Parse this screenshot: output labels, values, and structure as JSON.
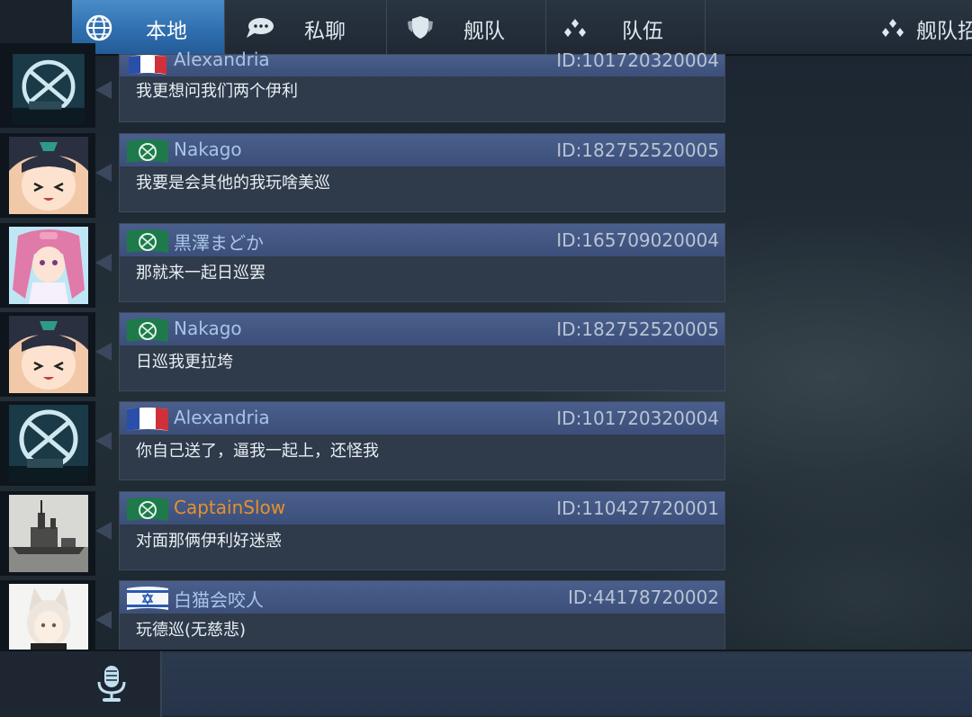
{
  "tabs": [
    {
      "label": "本地",
      "icon": "globe-icon",
      "active": true
    },
    {
      "label": "私聊",
      "icon": "speech-bubble-icon",
      "active": false
    },
    {
      "label": "舰队",
      "icon": "shield-icon",
      "active": false
    },
    {
      "label": "队伍",
      "icon": "team-dots-icon",
      "active": false
    },
    {
      "label": "舰队招",
      "icon": "team-dots-icon",
      "active": false
    }
  ],
  "messages": [
    {
      "name": "Alexandria",
      "id": "ID:101720320004",
      "text": "我更想问我们两个伊利",
      "flag": "france-flag",
      "avatar": "ship-emblem-avatar"
    },
    {
      "name": "Nakago",
      "id": "ID:182752520005",
      "text": "我要是会其他的我玩啥美巡",
      "flag": "green-emblem-flag",
      "avatar": "anime-girl-avatar"
    },
    {
      "name": "黒澤まどか",
      "id": "ID:165709020004",
      "text": "那就来一起日巡罢",
      "flag": "green-emblem-flag",
      "avatar": "pink-hair-girl-avatar"
    },
    {
      "name": "Nakago",
      "id": "ID:182752520005",
      "text": "日巡我更拉垮",
      "flag": "green-emblem-flag",
      "avatar": "anime-girl-avatar"
    },
    {
      "name": "Alexandria",
      "id": "ID:101720320004",
      "text": "你自己送了，逼我一起上，还怪我",
      "flag": "france-flag",
      "avatar": "ship-emblem-avatar"
    },
    {
      "name": "CaptainSlow",
      "id": "ID:110427720001",
      "text": "对面那俩伊利好迷惑",
      "flag": "green-emblem-flag",
      "avatar": "battleship-photo-avatar",
      "name_color": "#e8902a"
    },
    {
      "name": "白猫会咬人",
      "id": "ID:44178720002",
      "text": "玩德巡(无慈悲)",
      "flag": "israel-flag",
      "avatar": "white-cat-girl-avatar"
    }
  ],
  "input": {
    "placeholder": "",
    "mic_icon": "microphone-icon"
  }
}
